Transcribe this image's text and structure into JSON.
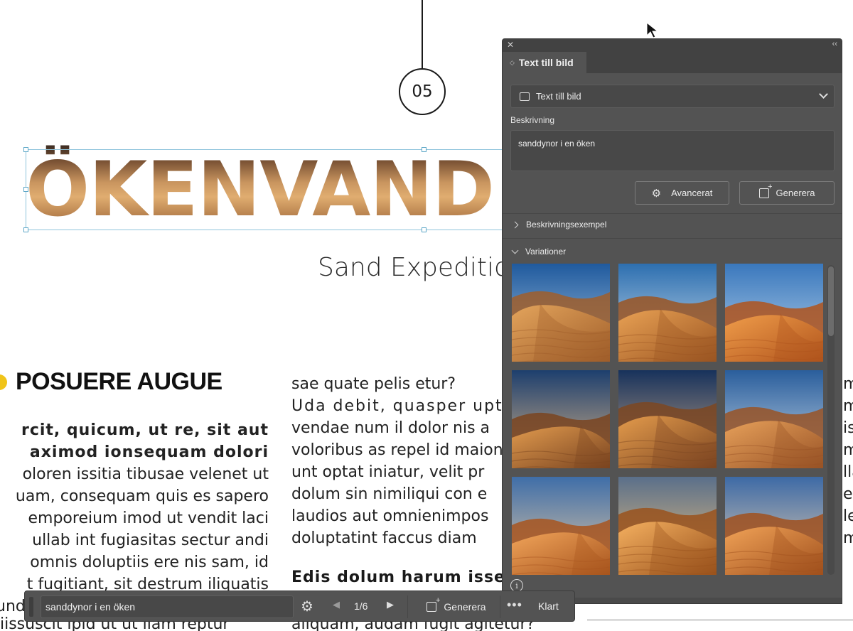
{
  "document": {
    "step_number": "05",
    "title": "ÖKENVAND",
    "subtitle": "Sand Expeditior",
    "heading": "POSUERE AUGUE",
    "col1_lines": [
      "rcit, quicum, ut re, sit aut",
      "aximod ionsequam dolori",
      "oloren issitia tibusae velenet ut",
      "uam, consequam quis es sapero",
      "emporeium imod ut vendit laci",
      "ullab int fugiasitas sectur andi",
      "omnis doluptiis ere nis sam, id",
      "t fugitiant, sit destrum iliquatis",
      "und"
    ],
    "col1_tail": "iissuscit ipid ut ut liam reptur",
    "col2_lines": [
      "sae quate pelis etur?",
      "Uda debit, quasper upt",
      "vendae num il dolor nis a",
      "voloribus as repel id maion",
      "unt optat iniatur, velit pr",
      "dolum sin nimiliqui con e",
      "laudios aut omnienimpos",
      "doluptatint faccus diam"
    ],
    "col2_heading": "Edis dolum harum isse",
    "col2_tail": "aliquam, audam fugit agitetur?",
    "col3_lines": [
      "m",
      "m",
      "is",
      "m",
      "lla",
      "es",
      "le",
      "m"
    ]
  },
  "panel": {
    "tab_label": "Text till bild",
    "mode_dropdown": "Text till bild",
    "description_label": "Beskrivning",
    "description_value": "sanddynor i en öken",
    "advanced_button": "Avancerat",
    "generate_button": "Generera",
    "examples_section": "Beskrivningsexempel",
    "variations_section": "Variationer",
    "info_icon": "i"
  },
  "taskbar": {
    "prompt_value": "sanddynor i en öken",
    "page_counter": "1/6",
    "generate_button": "Generera",
    "more_label": "•••",
    "done_button": "Klart"
  },
  "icons": {
    "close": "close-icon",
    "collapse": "collapse-icon",
    "gear": "gear-icon",
    "generate": "generate-icon",
    "prev": "chevron-left-icon",
    "next": "chevron-right-icon",
    "info": "info-icon"
  },
  "colors": {
    "panel_bg": "#535353",
    "accent_dot": "#f0c419",
    "sand": "#d98a3a",
    "sky": "#3f7fbf"
  },
  "variations": [
    {
      "sky_top": "#1f5a9e",
      "sky_bottom": "#a9c7e0",
      "dune_light": "#e3a45c",
      "dune_dark": "#a05e2a"
    },
    {
      "sky_top": "#2d6fb0",
      "sky_bottom": "#cfe0ee",
      "dune_light": "#e8a154",
      "dune_dark": "#9b5522"
    },
    {
      "sky_top": "#3a78bd",
      "sky_bottom": "#b9d3ea",
      "dune_light": "#ef9c4a",
      "dune_dark": "#b0541c"
    },
    {
      "sky_top": "#1d3f6e",
      "sky_bottom": "#d8b58a",
      "dune_light": "#e09a4e",
      "dune_dark": "#7a4420"
    },
    {
      "sky_top": "#17325c",
      "sky_bottom": "#c9a98a",
      "dune_light": "#e39b4c",
      "dune_dark": "#7d4621"
    },
    {
      "sky_top": "#2a5e9c",
      "sky_bottom": "#c7d8e8",
      "dune_light": "#e6a05a",
      "dune_dark": "#995326"
    },
    {
      "sky_top": "#3f6ea8",
      "sky_bottom": "#e3c9a6",
      "dune_light": "#f0a45a",
      "dune_dark": "#a8551e"
    },
    {
      "sky_top": "#5a6f8a",
      "sky_bottom": "#f1c680",
      "dune_light": "#f4b060",
      "dune_dark": "#9a521c"
    },
    {
      "sky_top": "#3d6aa6",
      "sky_bottom": "#ead2b2",
      "dune_light": "#f0a257",
      "dune_dark": "#a0501d"
    }
  ]
}
